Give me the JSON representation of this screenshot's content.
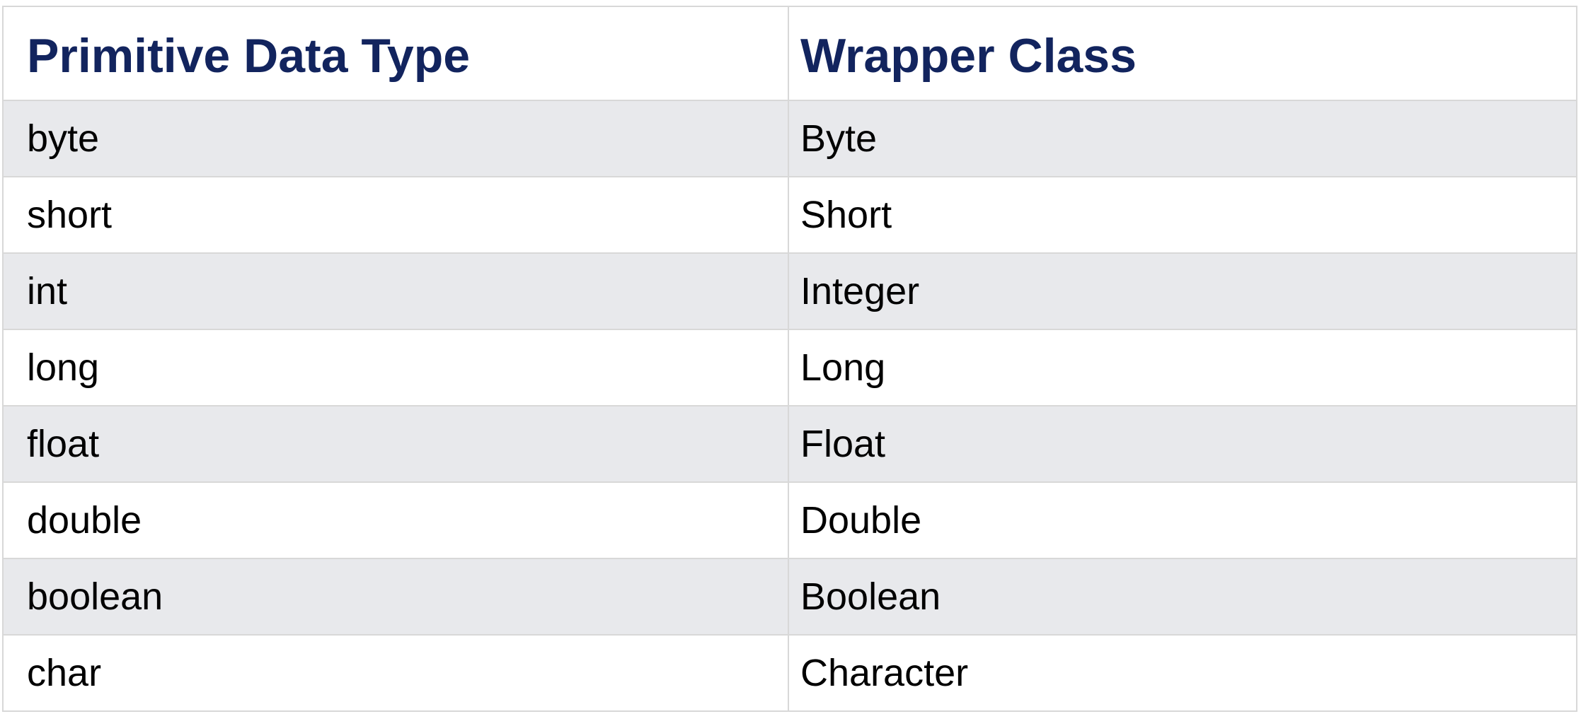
{
  "table": {
    "headers": [
      "Primitive Data Type",
      "Wrapper Class"
    ],
    "rows": [
      [
        "byte",
        "Byte"
      ],
      [
        "short",
        "Short"
      ],
      [
        "int",
        "Integer"
      ],
      [
        "long",
        "Long"
      ],
      [
        "float",
        "Float"
      ],
      [
        "double",
        "Double"
      ],
      [
        "boolean",
        "Boolean"
      ],
      [
        "char",
        "Character"
      ]
    ]
  },
  "colors": {
    "header_text": "#12245e",
    "striped_row": "#e8e9ec",
    "plain_row": "#ffffff",
    "grid_line": "#d8d8d8"
  }
}
